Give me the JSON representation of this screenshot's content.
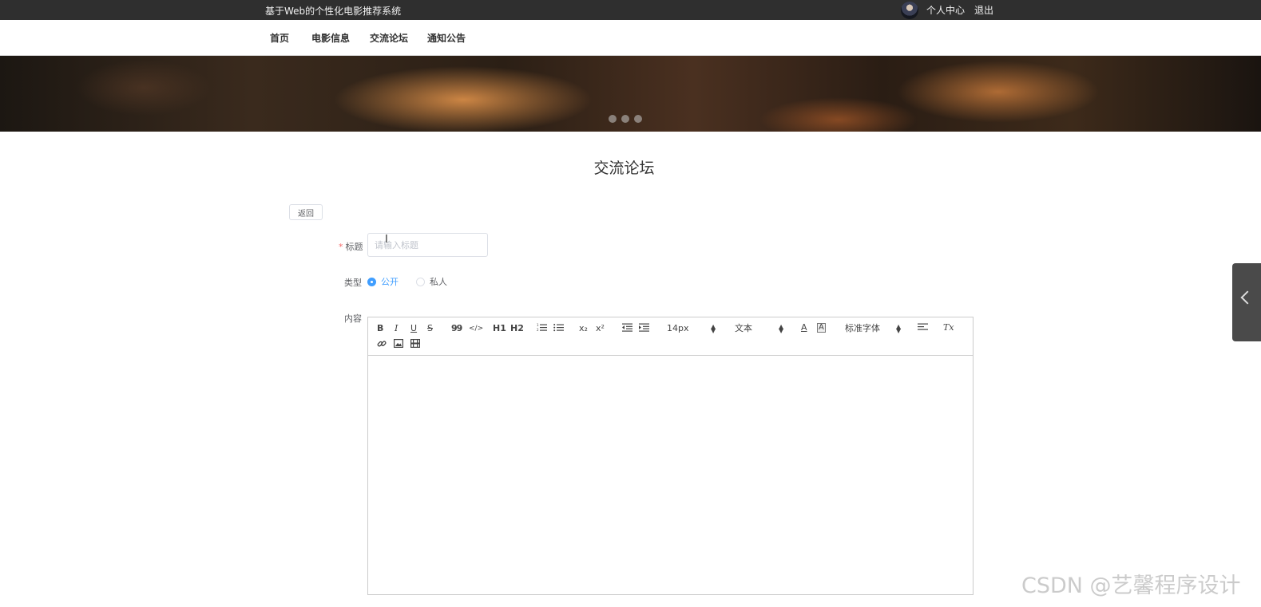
{
  "header": {
    "site_title": "基于Web的个性化电影推荐系统",
    "user_center": "个人中心",
    "logout": "退出"
  },
  "nav": {
    "items": [
      "首页",
      "电影信息",
      "交流论坛",
      "通知公告"
    ]
  },
  "banner": {
    "slide_count": 3
  },
  "page": {
    "heading": "交流论坛",
    "back_label": "返回"
  },
  "form": {
    "title_label": "标题",
    "title_placeholder": "请输入标题",
    "title_value": "",
    "type_label": "类型",
    "type_options": [
      "公开",
      "私人"
    ],
    "type_selected": "公开",
    "content_label": "内容"
  },
  "editor": {
    "bold": "B",
    "italic": "I",
    "underline": "U",
    "strike": "S",
    "quote": "99",
    "code": "</>",
    "h1": "H1",
    "h2": "H2",
    "sub": "x₂",
    "sup": "x²",
    "size_value": "14px",
    "header_value": "文本",
    "font_value": "标准字体",
    "clean": "Tx"
  },
  "watermark": "CSDN @艺馨程序设计",
  "colors": {
    "primary": "#409eff",
    "topbar": "#2f2f2f",
    "required": "#f56c6c"
  }
}
